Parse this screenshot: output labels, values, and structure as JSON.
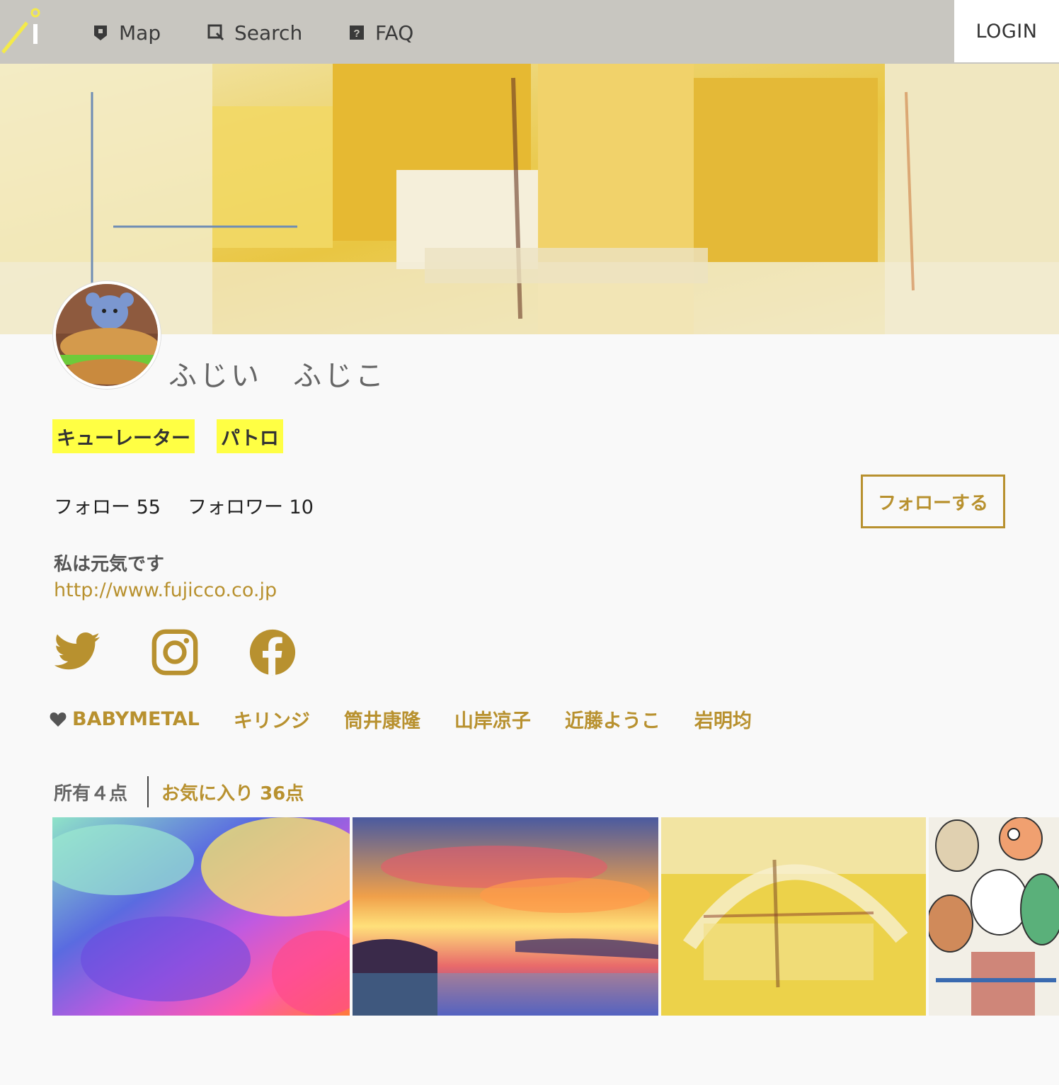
{
  "nav": {
    "items": [
      {
        "label": "Map",
        "icon": "map-pin-icon"
      },
      {
        "label": "Search",
        "icon": "search-icon"
      },
      {
        "label": "FAQ",
        "icon": "faq-icon"
      }
    ],
    "login_label": "LOGIN"
  },
  "profile": {
    "name": "ふじい　ふじこ",
    "roles": [
      "キューレーター",
      "パトロ"
    ],
    "follow_label": "フォロー",
    "follow_count": "55",
    "follower_label": "フォロワー",
    "follower_count": "10",
    "follow_button": "フォローする",
    "bio": "私は元気です",
    "url": "http://www.fujicco.co.jp",
    "social": [
      "twitter-icon",
      "instagram-icon",
      "facebook-icon"
    ]
  },
  "favorites": [
    "BABYMETAL",
    "キリンジ",
    "筒井康隆",
    "山岸凉子",
    "近藤ようこ",
    "岩明均"
  ],
  "collection_tabs": {
    "owned": "所有４点",
    "favorites": "お気に入り 36点"
  },
  "colors": {
    "accent": "#b8912f",
    "role_highlight": "#ffff44",
    "nav_bg": "#c8c6c0"
  }
}
